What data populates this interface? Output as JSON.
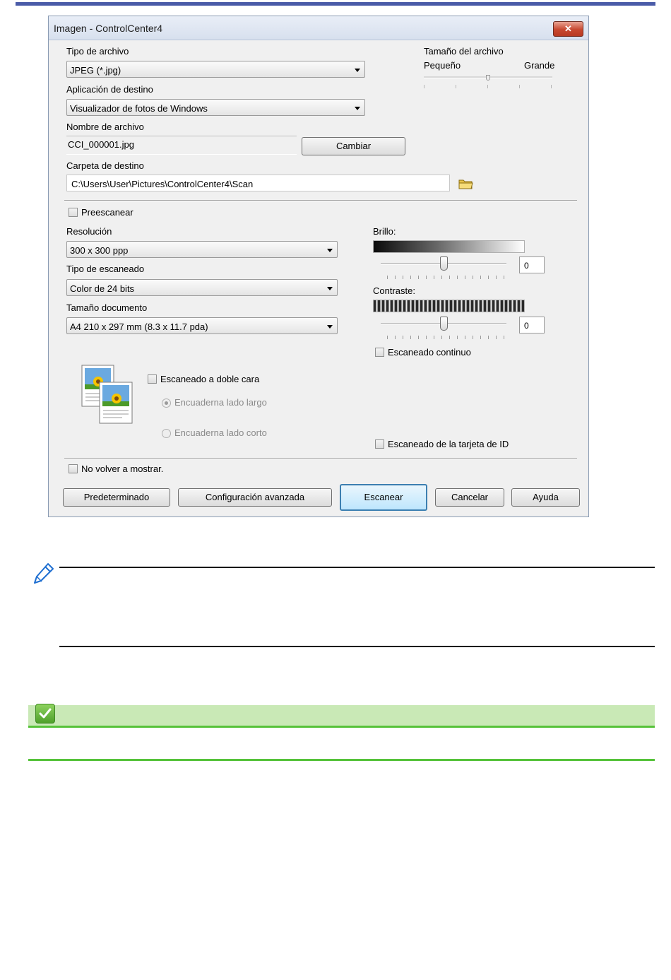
{
  "window": {
    "title": "Imagen - ControlCenter4",
    "close_label": "✕"
  },
  "file_type": {
    "label": "Tipo de archivo",
    "value": "JPEG (*.jpg)"
  },
  "file_size": {
    "label": "Tamaño del archivo",
    "min_label": "Pequeño",
    "max_label": "Grande",
    "level": 0.5
  },
  "target_app": {
    "label": "Aplicación de destino",
    "value": "Visualizador de fotos de Windows"
  },
  "file_name": {
    "label": "Nombre de archivo",
    "value": "CCI_000001.jpg",
    "change_button": "Cambiar"
  },
  "destination_folder": {
    "label": "Carpeta de destino",
    "value": "C:\\Users\\User\\Pictures\\ControlCenter4\\Scan"
  },
  "prescan": {
    "label": "Preescanear",
    "checked": false
  },
  "resolution": {
    "label": "Resolución",
    "value": "300 x 300 ppp"
  },
  "scan_type": {
    "label": "Tipo de escaneado",
    "value": "Color de 24 bits"
  },
  "document_size": {
    "label": "Tamaño documento",
    "value": "A4 210 x 297 mm (8.3 x 11.7 pda)"
  },
  "brightness": {
    "label": "Brillo:",
    "value": "0"
  },
  "contrast": {
    "label": "Contraste:",
    "value": "0"
  },
  "continuous_scan": {
    "label": "Escaneado continuo",
    "checked": false
  },
  "duplex": {
    "label": "Escaneado a doble cara",
    "checked": false,
    "options": [
      "Encuaderna lado largo",
      "Encuaderna lado corto"
    ],
    "selected": 0
  },
  "id_card_scan": {
    "label": "Escaneado de la tarjeta de ID",
    "checked": false
  },
  "dont_show_again": {
    "label": "No volver a mostrar.",
    "checked": false
  },
  "buttons": {
    "default": "Predeterminado",
    "advanced": "Configuración avanzada",
    "scan": "Escanear",
    "cancel": "Cancelar",
    "help": "Ayuda"
  },
  "colors": {
    "top_rule": "#4a5ba8",
    "related_bar": "#c9e9b6",
    "related_line": "#56c23a"
  }
}
